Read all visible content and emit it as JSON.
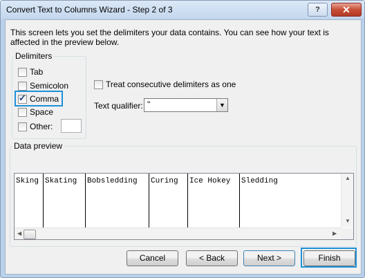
{
  "window": {
    "title": "Convert Text to Columns Wizard - Step 2 of 3",
    "help_button": "?",
    "close_button": "✕"
  },
  "description": "This screen lets you set the delimiters your data contains.  You can see how your text is affected in the preview below.",
  "delimiters": {
    "label": "Delimiters",
    "options": [
      {
        "label": "Tab",
        "checked": false
      },
      {
        "label": "Semicolon",
        "checked": false
      },
      {
        "label": "Comma",
        "checked": true
      },
      {
        "label": "Space",
        "checked": false
      },
      {
        "label": "Other:",
        "checked": false
      }
    ],
    "other_value": ""
  },
  "consecutive": {
    "label": "Treat consecutive delimiters as one",
    "checked": false
  },
  "qualifier": {
    "label": "Text qualifier:",
    "value": "\""
  },
  "preview": {
    "label": "Data preview",
    "columns": [
      "Sking",
      "Skating",
      "Bobsledding",
      "Curing",
      "Ice Hokey",
      "Sledding"
    ]
  },
  "buttons": {
    "cancel": "Cancel",
    "back": "< Back",
    "next": "Next >",
    "finish": "Finish"
  },
  "colors": {
    "highlight": "#1e90d8"
  }
}
